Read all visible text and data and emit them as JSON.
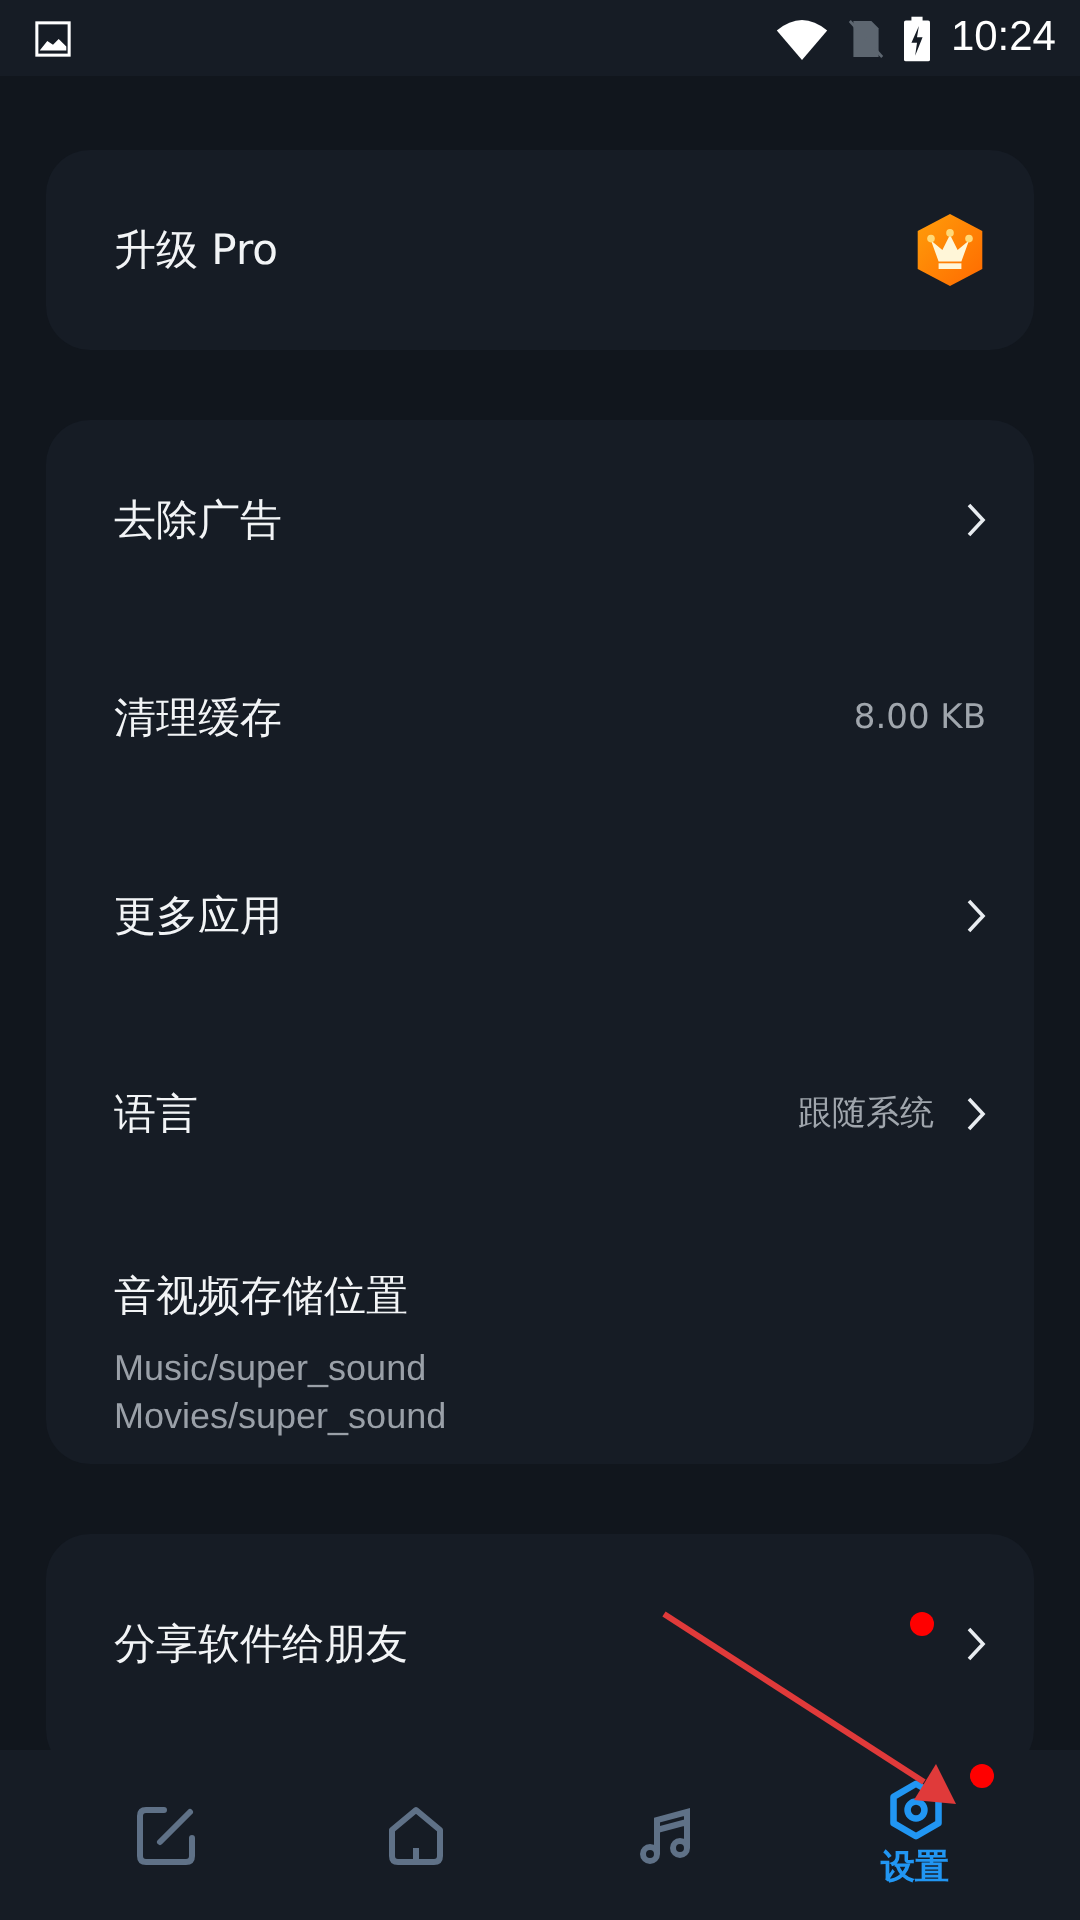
{
  "status_bar": {
    "time": "10:24"
  },
  "pro": {
    "label": "升级 Pro"
  },
  "settings": [
    {
      "kind": "link",
      "label": "去除广告"
    },
    {
      "kind": "value",
      "label": "清理缓存",
      "value": "8.00 KB"
    },
    {
      "kind": "link",
      "label": "更多应用"
    },
    {
      "kind": "link",
      "label": "语言",
      "value": "跟随系统"
    },
    {
      "kind": "paths",
      "label": "音视频存储位置",
      "lines": [
        "Music/super_sound",
        "Movies/super_sound"
      ]
    }
  ],
  "share": {
    "label": "分享软件给朋友",
    "badge": true
  },
  "tabs": [
    {
      "kind": "edit",
      "selected": false,
      "badge": false
    },
    {
      "kind": "home",
      "selected": false,
      "badge": false
    },
    {
      "kind": "music",
      "selected": false,
      "badge": false
    },
    {
      "kind": "settings",
      "label": "设置",
      "selected": true,
      "badge": true
    }
  ],
  "annotation": {
    "kind": "arrow"
  }
}
